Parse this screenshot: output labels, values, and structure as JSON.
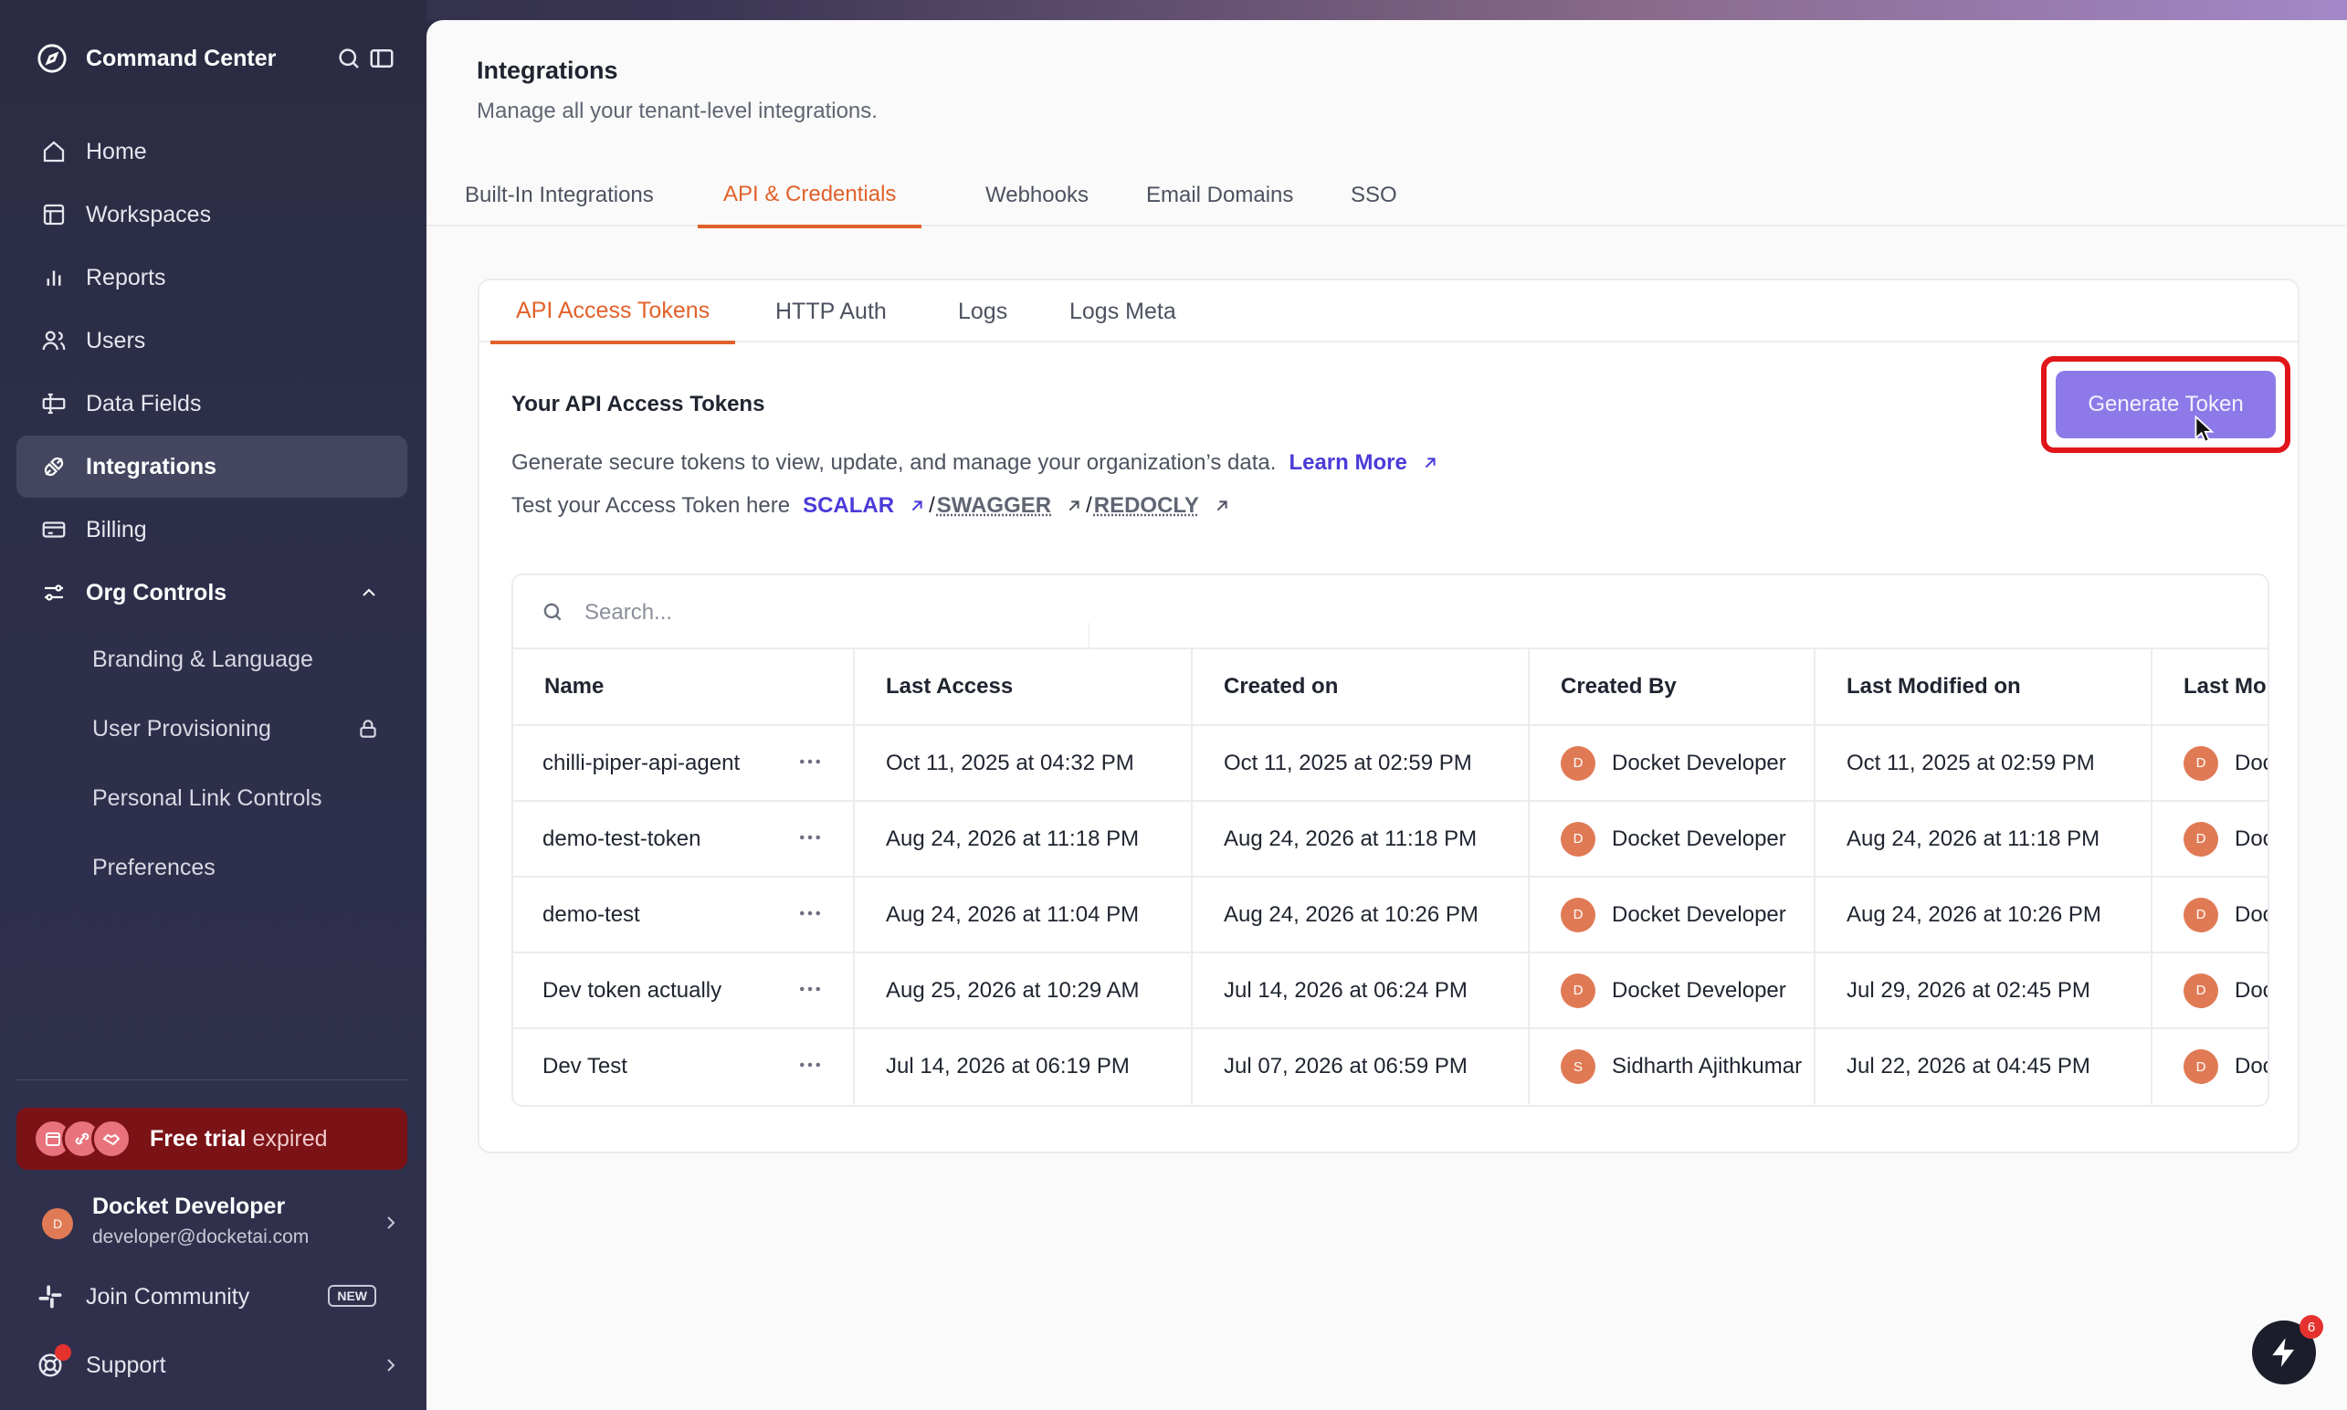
{
  "app": {
    "title": "Command Center"
  },
  "sidebar": {
    "items": [
      {
        "label": "Home",
        "icon": "home-icon"
      },
      {
        "label": "Workspaces",
        "icon": "workspaces-icon"
      },
      {
        "label": "Reports",
        "icon": "reports-icon"
      },
      {
        "label": "Users",
        "icon": "users-icon"
      },
      {
        "label": "Data Fields",
        "icon": "data-fields-icon"
      },
      {
        "label": "Integrations",
        "icon": "integrations-icon",
        "active": true
      },
      {
        "label": "Billing",
        "icon": "billing-icon"
      }
    ],
    "org_controls": {
      "label": "Org Controls",
      "sub_items": [
        "Branding & Language",
        "User Provisioning",
        "Personal Link Controls",
        "Preferences"
      ]
    },
    "trial": {
      "bold": "Free trial",
      "rest": " expired"
    },
    "user": {
      "initial": "D",
      "name": "Docket Developer",
      "email": "developer@docketai.com"
    },
    "join": {
      "label": "Join Community",
      "badge": "NEW"
    },
    "support": {
      "label": "Support"
    }
  },
  "page": {
    "title": "Integrations",
    "subtitle": "Manage all your tenant-level integrations.",
    "tabs": [
      "Built-In Integrations",
      "API & Credentials",
      "Webhooks",
      "Email Domains",
      "SSO"
    ],
    "active_tab": "API & Credentials"
  },
  "api": {
    "subtabs": [
      "API Access Tokens",
      "HTTP Auth",
      "Logs",
      "Logs Meta"
    ],
    "section_title": "Your API Access Tokens",
    "description": "Generate secure tokens to view, update, and manage your organization’s data.",
    "learn_more": "Learn More",
    "test_prefix": "Test your Access Token here",
    "scalar": "SCALAR",
    "swagger": "SWAGGER",
    "redocly": "REDOCLY",
    "slash": "/",
    "generate_label": "Generate Token",
    "search_placeholder": "Search..."
  },
  "table": {
    "columns": [
      "Name",
      "Last Access",
      "Created on",
      "Created By",
      "Last Modified on",
      "Last Mo"
    ],
    "rows": [
      {
        "name": "chilli-piper-api-agent",
        "last_access": "Oct 11, 2025 at 04:32 PM",
        "created_on": "Oct 11, 2025 at 02:59 PM",
        "created_by": "Docket Developer",
        "created_by_initial": "D",
        "last_modified": "Oct 11, 2025 at 02:59 PM",
        "last_mod_by": "Doc",
        "last_mod_initial": "D"
      },
      {
        "name": "demo-test-token",
        "last_access": "Aug 24, 2026 at 11:18 PM",
        "created_on": "Aug 24, 2026 at 11:18 PM",
        "created_by": "Docket Developer",
        "created_by_initial": "D",
        "last_modified": "Aug 24, 2026 at 11:18 PM",
        "last_mod_by": "Doc",
        "last_mod_initial": "D"
      },
      {
        "name": "demo-test",
        "last_access": "Aug 24, 2026 at 11:04 PM",
        "created_on": "Aug 24, 2026 at 10:26 PM",
        "created_by": "Docket Developer",
        "created_by_initial": "D",
        "last_modified": "Aug 24, 2026 at 10:26 PM",
        "last_mod_by": "Doc",
        "last_mod_initial": "D"
      },
      {
        "name": "Dev token actually",
        "last_access": "Aug 25, 2026 at 10:29 AM",
        "created_on": "Jul 14, 2026 at 06:24 PM",
        "created_by": "Docket Developer",
        "created_by_initial": "D",
        "last_modified": "Jul 29, 2026 at 02:45 PM",
        "last_mod_by": "Doc",
        "last_mod_initial": "D"
      },
      {
        "name": "Dev Test",
        "last_access": "Jul 14, 2026 at 06:19 PM",
        "created_on": "Jul 07, 2026 at 06:59 PM",
        "created_by": "Sidharth Ajithkumar",
        "created_by_initial": "S",
        "last_modified": "Jul 22, 2026 at 04:45 PM",
        "last_mod_by": "Doc",
        "last_mod_initial": "D"
      }
    ]
  },
  "fab": {
    "count": "6"
  },
  "colors": {
    "accent": "#e2612a",
    "primary_button": "#8d7ae8",
    "highlight": "#e1161a",
    "link": "#4a3bd8",
    "avatar": "#e07a55"
  }
}
